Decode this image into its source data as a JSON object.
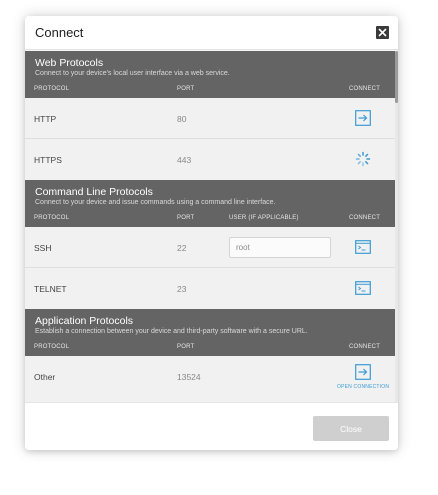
{
  "dialog": {
    "title": "Connect",
    "close_icon": "close-icon",
    "close_button_label": "Close"
  },
  "columns": {
    "protocol": "PROTOCOL",
    "port": "PORT",
    "user": "USER (IF APPLICABLE)",
    "connect": "CONNECT"
  },
  "web": {
    "title": "Web Protocols",
    "subtitle": "Connect to your device's local user interface via a web service.",
    "rows": [
      {
        "protocol": "HTTP",
        "port": "80",
        "action_icon": "open-connection-icon"
      },
      {
        "protocol": "HTTPS",
        "port": "443",
        "action_icon": "loading-spinner-icon"
      }
    ]
  },
  "cli": {
    "title": "Command Line Protocols",
    "subtitle": "Connect to your device and issue commands using a command line interface.",
    "rows": [
      {
        "protocol": "SSH",
        "port": "22",
        "user": "root",
        "action_icon": "terminal-icon"
      },
      {
        "protocol": "TELNET",
        "port": "23",
        "action_icon": "terminal-icon"
      }
    ]
  },
  "app": {
    "title": "Application Protocols",
    "subtitle": "Establish a connection between your device and third-party software with a secure URL.",
    "rows": [
      {
        "protocol": "Other",
        "port": "13524",
        "action_icon": "open-connection-icon",
        "action_label": "OPEN CONNECTION"
      }
    ]
  },
  "colors": {
    "section_header": "#646464",
    "accent_blue": "#3a9bd5",
    "close_button_disabled": "#cfcfcf"
  }
}
